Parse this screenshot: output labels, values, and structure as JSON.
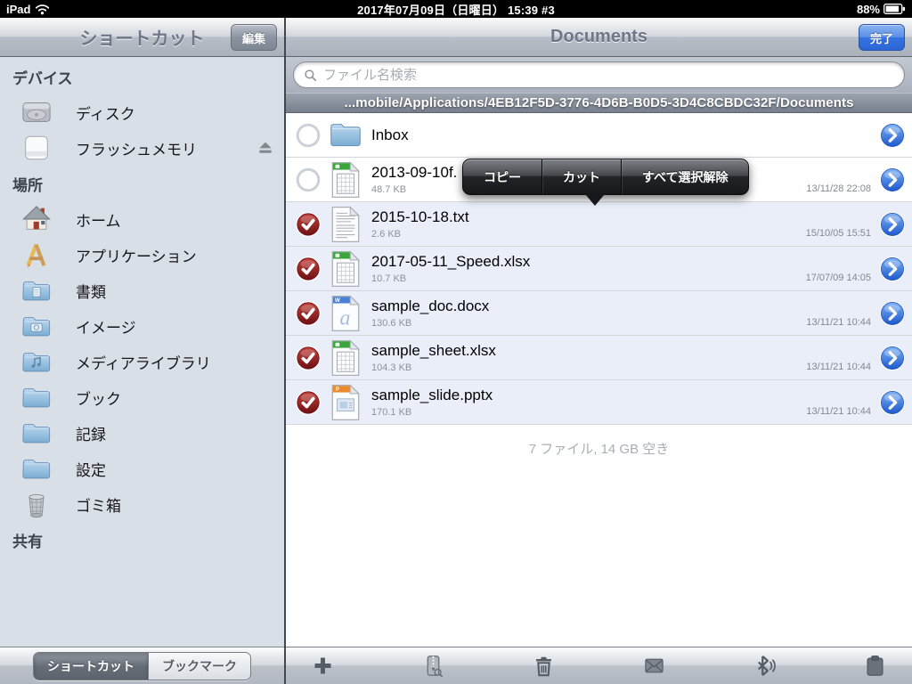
{
  "colors": {
    "accent_blue": "#2f6fdd",
    "selected_row": "#e9eef9",
    "check_red": "#8e1a20"
  },
  "status_bar": {
    "carrier": "iPad",
    "datetime": "2017年07月09日（日曜日） 15:39 #3",
    "battery_percent": "88%"
  },
  "sidebar": {
    "title": "ショートカット",
    "edit_button": "編集",
    "sections": [
      {
        "id": "devices",
        "label": "デバイス",
        "items": [
          {
            "id": "disk",
            "label": "ディスク",
            "icon": "disk"
          },
          {
            "id": "flash-memory",
            "label": "フラッシュメモリ",
            "icon": "flash",
            "eject": true
          }
        ]
      },
      {
        "id": "places",
        "label": "場所",
        "items": [
          {
            "id": "home",
            "label": "ホーム",
            "icon": "home"
          },
          {
            "id": "applications",
            "label": "アプリケーション",
            "icon": "apps"
          },
          {
            "id": "documents",
            "label": "書類",
            "icon": "folder-doc"
          },
          {
            "id": "images",
            "label": "イメージ",
            "icon": "folder-camera"
          },
          {
            "id": "media-library",
            "label": "メディアライブラリ",
            "icon": "folder-music"
          },
          {
            "id": "books",
            "label": "ブック",
            "icon": "folder"
          },
          {
            "id": "records",
            "label": "記録",
            "icon": "folder"
          },
          {
            "id": "settings",
            "label": "設定",
            "icon": "folder"
          },
          {
            "id": "trash",
            "label": "ゴミ箱",
            "icon": "trash-bin"
          }
        ]
      },
      {
        "id": "shared",
        "label": "共有",
        "items": []
      }
    ],
    "tabs": [
      {
        "id": "shortcuts",
        "label": "ショートカット",
        "selected": true
      },
      {
        "id": "bookmarks",
        "label": "ブックマーク",
        "selected": false
      }
    ]
  },
  "main": {
    "title": "Documents",
    "done_button": "完了",
    "search_placeholder": "ファイル名検索",
    "path": "...mobile/Applications/4EB12F5D-3776-4D6B-B0D5-3D4C8CBDC32F/Documents",
    "files": [
      {
        "name": "Inbox",
        "type": "folder",
        "checked": false
      },
      {
        "name": "2013-09-10f.",
        "type": "xlsx",
        "size": "48.7 KB",
        "date": "13/11/28 22:08",
        "checked": false
      },
      {
        "name": "2015-10-18.txt",
        "type": "txt",
        "size": "2.6 KB",
        "date": "15/10/05 15:51",
        "checked": true
      },
      {
        "name": "2017-05-11_Speed.xlsx",
        "type": "xlsx",
        "size": "10.7 KB",
        "date": "17/07/09 14:05",
        "checked": true
      },
      {
        "name": "sample_doc.docx",
        "type": "docx",
        "size": "130.6 KB",
        "date": "13/11/21 10:44",
        "checked": true
      },
      {
        "name": "sample_sheet.xlsx",
        "type": "xlsx",
        "size": "104.3 KB",
        "date": "13/11/21 10:44",
        "checked": true
      },
      {
        "name": "sample_slide.pptx",
        "type": "pptx",
        "size": "170.1 KB",
        "date": "13/11/21 10:44",
        "checked": true
      }
    ],
    "summary": "7 ファイル, 14 GB 空き",
    "context_menu": {
      "items": [
        "コピー",
        "カット",
        "すべて選択解除"
      ]
    },
    "toolbar": [
      {
        "id": "add"
      },
      {
        "id": "zip"
      },
      {
        "id": "delete"
      },
      {
        "id": "mail"
      },
      {
        "id": "bluetooth"
      },
      {
        "id": "paste"
      }
    ]
  }
}
